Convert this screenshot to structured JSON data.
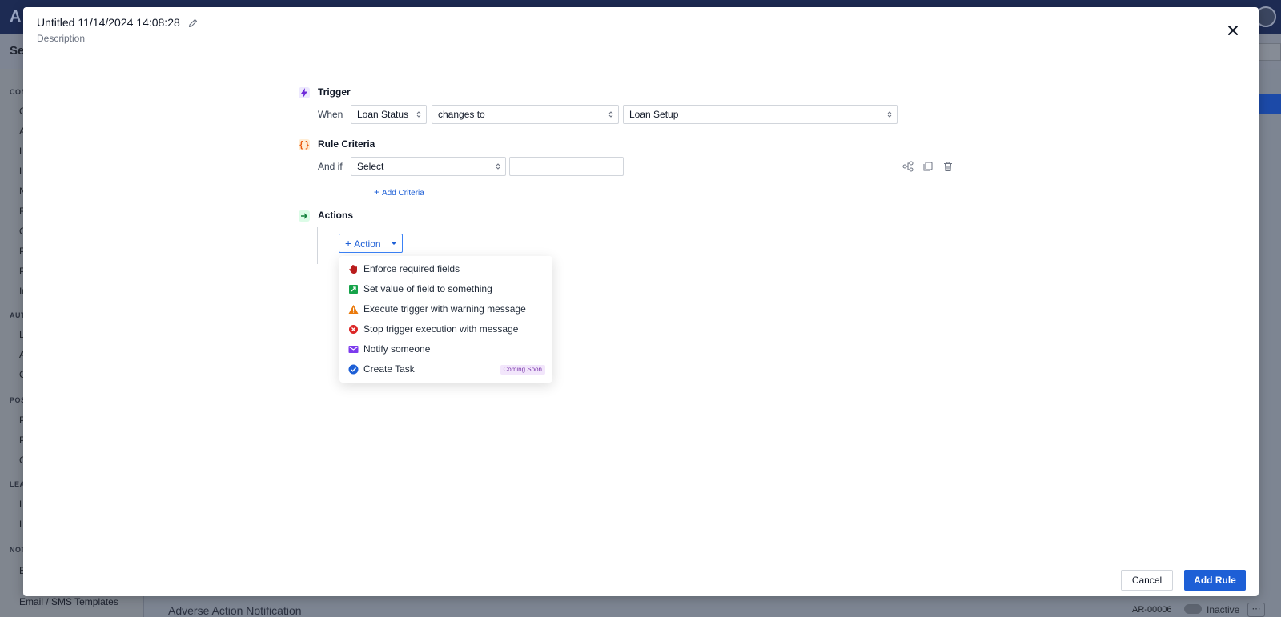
{
  "background": {
    "logo": "A",
    "page_title": "Se",
    "sidebar": {
      "sections": [
        "CON",
        "AUT",
        "POS",
        "LEA",
        "NOT"
      ],
      "items": [
        "C",
        "A",
        "L",
        "L",
        "N",
        "R",
        "C",
        "P",
        "P",
        "In",
        "L",
        "A",
        "C",
        "P",
        "P",
        "C",
        "L",
        "L",
        "E"
      ],
      "email_templates": "Email / SMS Templates"
    },
    "list_row": {
      "name": "Adverse Action Notification",
      "code": "AR-00006",
      "status": "Inactive",
      "menu": "⋯"
    }
  },
  "modal": {
    "title": "Untitled 11/14/2024 14:08:28",
    "description": "Description",
    "trigger": {
      "label": "Trigger",
      "when_label": "When",
      "field": "Loan Status",
      "operator": "changes to",
      "value": "Loan Setup"
    },
    "criteria": {
      "label": "Rule Criteria",
      "and_if_label": "And if",
      "select_value": "Select",
      "input_value": "",
      "add_label": "Add Criteria"
    },
    "actions": {
      "label": "Actions",
      "button_label": "Action",
      "menu": [
        {
          "label": "Enforce required fields",
          "icon": "hand-stop-icon"
        },
        {
          "label": "Set value of field to something",
          "icon": "set-value-icon"
        },
        {
          "label": "Execute trigger with warning message",
          "icon": "warning-icon"
        },
        {
          "label": "Stop trigger execution with message",
          "icon": "stop-icon"
        },
        {
          "label": "Notify someone",
          "icon": "envelope-icon"
        },
        {
          "label": "Create Task",
          "icon": "check-circle-icon",
          "badge": "Coming Soon"
        }
      ]
    },
    "footer": {
      "cancel_label": "Cancel",
      "submit_label": "Add Rule"
    }
  },
  "colors": {
    "primary": "#1d5fd6",
    "trigger_icon": "#6d28d9",
    "criteria_icon": "#ea580c",
    "actions_icon": "#15803d",
    "badge_bg": "#f2e6fb",
    "badge_text": "#7c3aad"
  }
}
